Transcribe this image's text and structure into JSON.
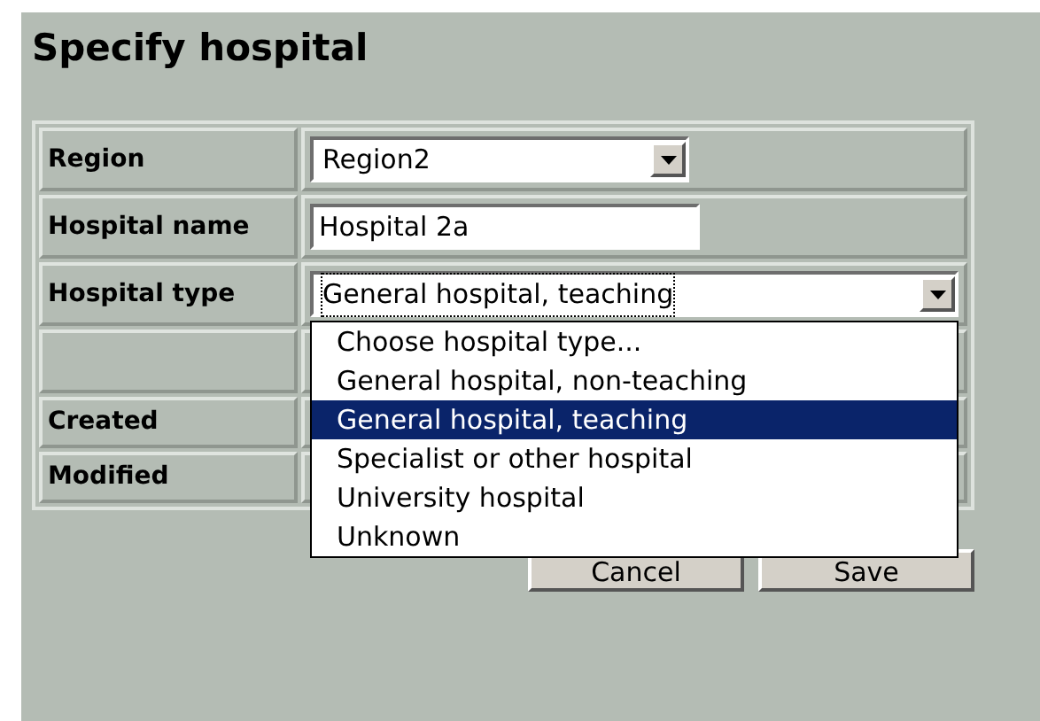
{
  "title": "Specify hospital",
  "form": {
    "rows": [
      {
        "kind": "select",
        "label": "Region",
        "value": "Region2",
        "expanded": false
      },
      {
        "kind": "text",
        "label": "Hospital name",
        "value": "Hospital 2a"
      },
      {
        "kind": "select",
        "label": "Hospital type",
        "value": "General hospital, teaching",
        "expanded": true,
        "options": [
          {
            "label": "Choose hospital type...",
            "selected": false
          },
          {
            "label": "General hospital, non-teaching",
            "selected": false
          },
          {
            "label": "General hospital, teaching",
            "selected": true
          },
          {
            "label": "Specialist or other hospital",
            "selected": false
          },
          {
            "label": "University hospital",
            "selected": false
          },
          {
            "label": "Unknown",
            "selected": false
          }
        ]
      },
      {
        "kind": "blank"
      },
      {
        "kind": "info",
        "label": "Created"
      },
      {
        "kind": "info",
        "label": "Modified"
      }
    ]
  },
  "buttons": [
    "Cancel",
    "Save"
  ]
}
